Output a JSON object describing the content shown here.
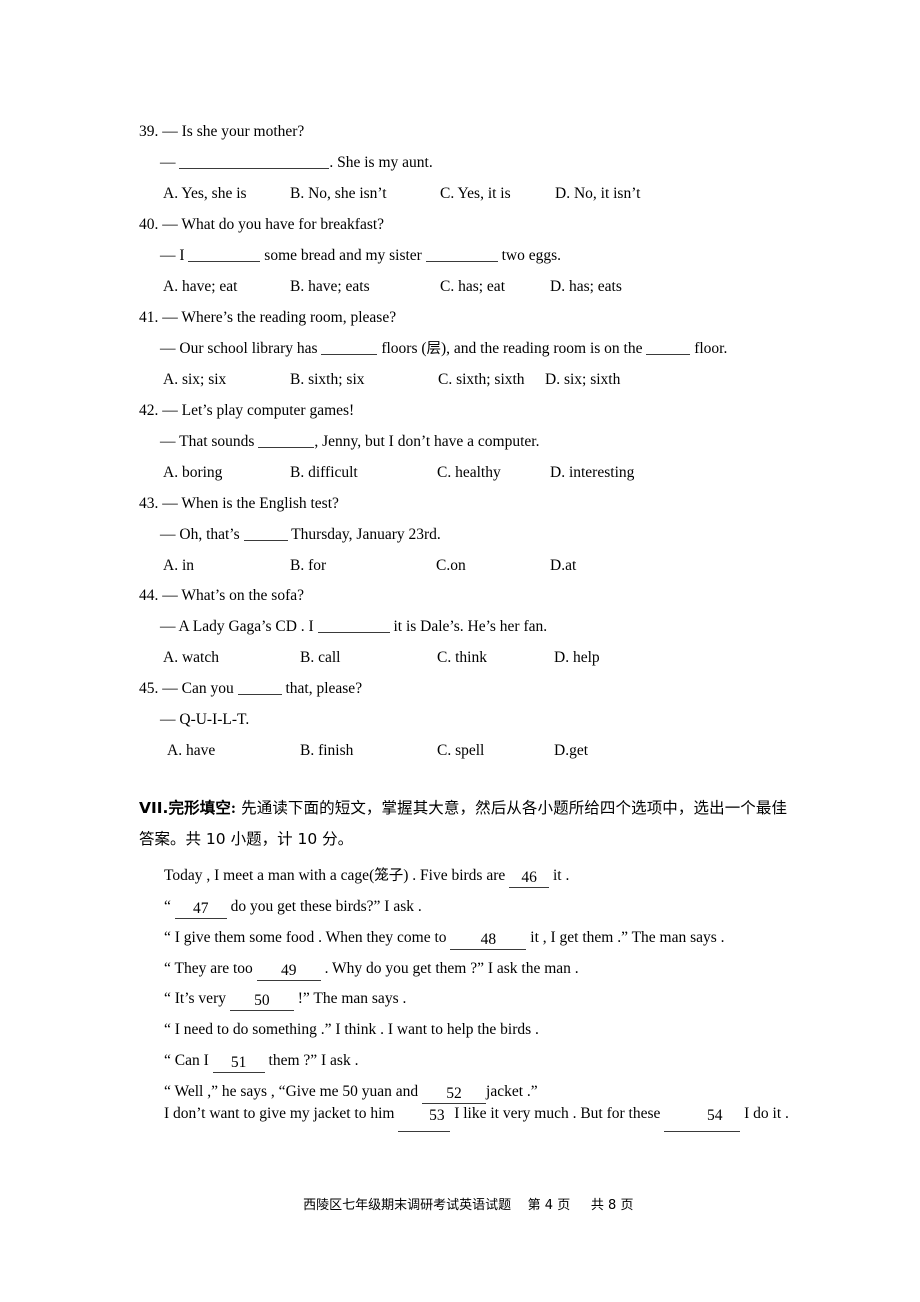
{
  "document": {
    "page_label": "exam-paper-page-4"
  },
  "questions": [
    {
      "number": "39.",
      "prompt": "— Is she your mother?",
      "answer_line_pre": "— ",
      "answer_line_post": ". She is my aunt.",
      "options": [
        "A. Yes, she is",
        "B. No, she isn’t",
        "C. Yes, it is",
        "D. No, it isn’t"
      ]
    },
    {
      "number": "40.",
      "prompt": "— What do you have for breakfast?",
      "answer_line_pre": "— I ",
      "answer_line_mid": " some bread and my sister ",
      "answer_line_post": " two eggs.",
      "options": [
        "A. have; eat",
        "B. have; eats",
        "C. has; eat",
        "D. has; eats"
      ]
    },
    {
      "number": "41.",
      "prompt": "— Where’s the reading room, please?",
      "answer_line_pre": "— Our school library has ",
      "answer_line_mid": " floors (",
      "answer_line_cn": "层",
      "answer_line_mid2": "), and the reading room is on the ",
      "answer_line_post": " floor.",
      "options": [
        "A. six; six",
        "B. sixth; six",
        "C. sixth; sixth",
        "D. six; sixth"
      ]
    },
    {
      "number": "42.",
      "prompt": "— Let’s play computer games!",
      "answer_line_pre": "— That sounds ",
      "answer_line_post": ", Jenny, but I don’t have a computer.",
      "options": [
        "A. boring",
        "B. difficult",
        "C. healthy",
        "D. interesting"
      ]
    },
    {
      "number": "43.",
      "prompt": "— When is the English test?",
      "answer_line_pre": "— Oh, that’s ",
      "answer_line_post": " Thursday, January 23rd.",
      "options": [
        "A. in",
        "B. for",
        "C.on",
        "D.at"
      ]
    },
    {
      "number": "44.",
      "prompt": "— What’s on the sofa?",
      "answer_line_pre": "— A Lady Gaga’s CD . I ",
      "answer_line_post": " it is Dale’s. He’s her fan.",
      "options": [
        "A. watch",
        "B. call",
        "C. think",
        "D. help"
      ]
    },
    {
      "number": "45.",
      "prompt_pre": "— Can you ",
      "prompt_post": " that, please?",
      "answer_line": "— Q-U-I-L-T.",
      "options": [
        "A. have",
        "B. finish",
        "C. spell",
        "D.get"
      ]
    }
  ],
  "section": {
    "label": "VII.完形填空",
    "colon": ":",
    "instruction": " 先通读下面的短文，掌握其大意，然后从各小题所给四个选项中，选出一个最佳答案。共 10 小题，计 10 分。"
  },
  "cloze": {
    "lines": [
      {
        "parts": [
          {
            "t": "Today , I meet a man with a cage("
          },
          {
            "t": "笼子",
            "cn": true
          },
          {
            "t": ") . Five birds are "
          },
          {
            "blank": "46",
            "w": "nb-a"
          },
          {
            "t": " it ."
          }
        ]
      },
      {
        "parts": [
          {
            "t": "“ "
          },
          {
            "blank": "47",
            "w": "nb-b"
          },
          {
            "t": " do you get these birds?” I ask ."
          }
        ]
      },
      {
        "parts": [
          {
            "t": "“ I give them some food . When they come to "
          },
          {
            "blank": "48",
            "w": "nb-d"
          },
          {
            "t": " it , I get them .” The man says ."
          }
        ]
      },
      {
        "parts": [
          {
            "t": "“ They are too "
          },
          {
            "blank": "49",
            "w": "nb-c"
          },
          {
            "t": " . Why do you get them ?” I ask the man ."
          }
        ]
      },
      {
        "parts": [
          {
            "t": "“ It’s very "
          },
          {
            "blank": "50",
            "w": "nb-c"
          },
          {
            "t": " !” The man says ."
          }
        ]
      },
      {
        "parts": [
          {
            "t": "“ I need to do something .” I think . I want to help the birds ."
          }
        ]
      },
      {
        "parts": [
          {
            "t": "“ Can I "
          },
          {
            "blank": "51",
            "w": "nb-b"
          },
          {
            "t": " them ?” I ask ."
          }
        ]
      },
      {
        "parts": [
          {
            "t": "“ Well ,” he says , “Give me 50 yuan and "
          },
          {
            "blank": "52",
            "w": "nb-c"
          },
          {
            "t": "jacket .”"
          }
        ]
      }
    ],
    "final_paragraph": {
      "pre": "I don’t want to give my jacket to him ",
      "blank1": "53",
      "mid": " I like it very much . But for these ",
      "blank2": "54",
      "post": " I do it ."
    }
  },
  "footer": {
    "title": "西陵区七年级期末调研考试英语试题",
    "page_prefix": "第",
    "page_number": "4",
    "page_unit": "页",
    "total_prefix": "共",
    "total_number": "8",
    "total_unit": "页"
  }
}
